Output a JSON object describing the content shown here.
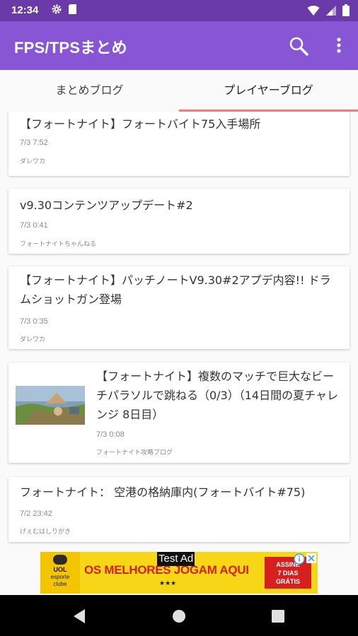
{
  "status_bar": {
    "time": "12:34"
  },
  "app_bar": {
    "title": "FPS/TPSまとめ"
  },
  "tabs": [
    {
      "label": "まとめブログ"
    },
    {
      "label": "プレイヤーブログ"
    }
  ],
  "articles": [
    {
      "title": "【フォートナイト】フォートバイト75入手場所",
      "date": "7/3 7:52",
      "source": "ダレワカ"
    },
    {
      "title": "v9.30コンテンツアップデート#2",
      "date": "7/3 0:41",
      "source": "フォートナイトちゃんねる"
    },
    {
      "title": "【フォートナイト】パッチノートV9.30#2アプデ内容!! ドラムショットガン登場",
      "date": "7/3 0:35",
      "source": "ダレワカ"
    },
    {
      "title": "【フォートナイト】複数のマッチで巨大なビーチパラソルで跳ねる（0/3）（14日間の夏チャレンジ 8日目）",
      "date": "7/3 0:08",
      "source": "フォートナイト攻略ブログ"
    },
    {
      "title": "フォートナイト： 空港の格納庫内(フォートバイト#75)",
      "date": "7/2 23:42",
      "source": "げぇむはしりがき"
    }
  ],
  "ad": {
    "label": "Test Ad",
    "logo_brand": "UOL",
    "logo_sub1": "esporte",
    "logo_sub2": "clube",
    "headline": "OS MELHORES JOGAM AQUI",
    "cta_line1": "ASSINE",
    "cta_line2": "7 DIAS",
    "cta_line3": "GRÁTIS",
    "colors": {
      "background": "#f6d617",
      "headline": "#d6201f"
    }
  },
  "colors": {
    "status_bar": "#6a3ba8",
    "app_bar": "#8856d4",
    "tab_indicator": "#ee7a86"
  }
}
